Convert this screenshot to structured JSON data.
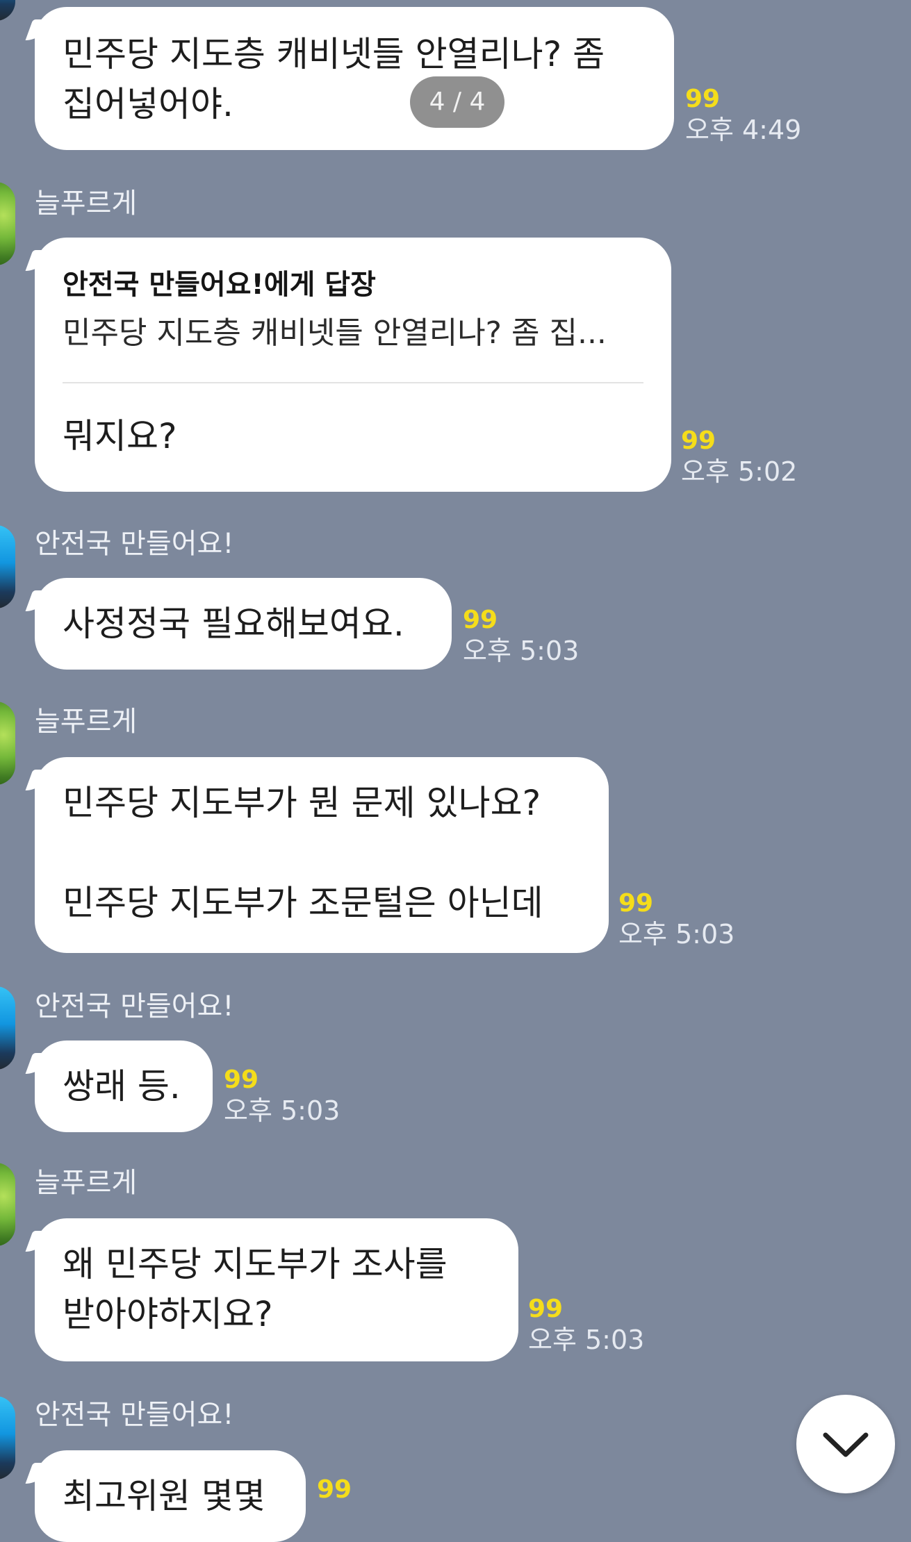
{
  "page_indicator": "4 / 4",
  "messages": [
    {
      "text": "민주당 지도층 캐비넷들 안열리나? 좀\n집어넣어야.",
      "unread": "99",
      "time": "오후 4:49"
    },
    {
      "sender": "늘푸르게",
      "reply_to": "안전국 만들어요!에게 답장",
      "quoted": "민주당 지도층 캐비넷들 안열리나? 좀 집...",
      "text": "뭐지요?",
      "unread": "99",
      "time": "오후 5:02"
    },
    {
      "sender": "안전국 만들어요!",
      "text": "사정정국 필요해보여요.",
      "unread": "99",
      "time": "오후 5:03"
    },
    {
      "sender": "늘푸르게",
      "text": "민주당 지도부가 뭔 문제 있나요?\n\n민주당 지도부가  조문털은 아닌데",
      "unread": "99",
      "time": "오후 5:03"
    },
    {
      "sender": "안전국 만들어요!",
      "text": "쌍래 등.",
      "unread": "99",
      "time": "오후 5:03"
    },
    {
      "sender": "늘푸르게",
      "text": "왜 민주당 지도부가  조사를\n받아야하지요?",
      "unread": "99",
      "time": "오후 5:03"
    },
    {
      "sender": "안전국 만들어요!",
      "text": "최고위원 몇몇",
      "unread": "99"
    }
  ]
}
